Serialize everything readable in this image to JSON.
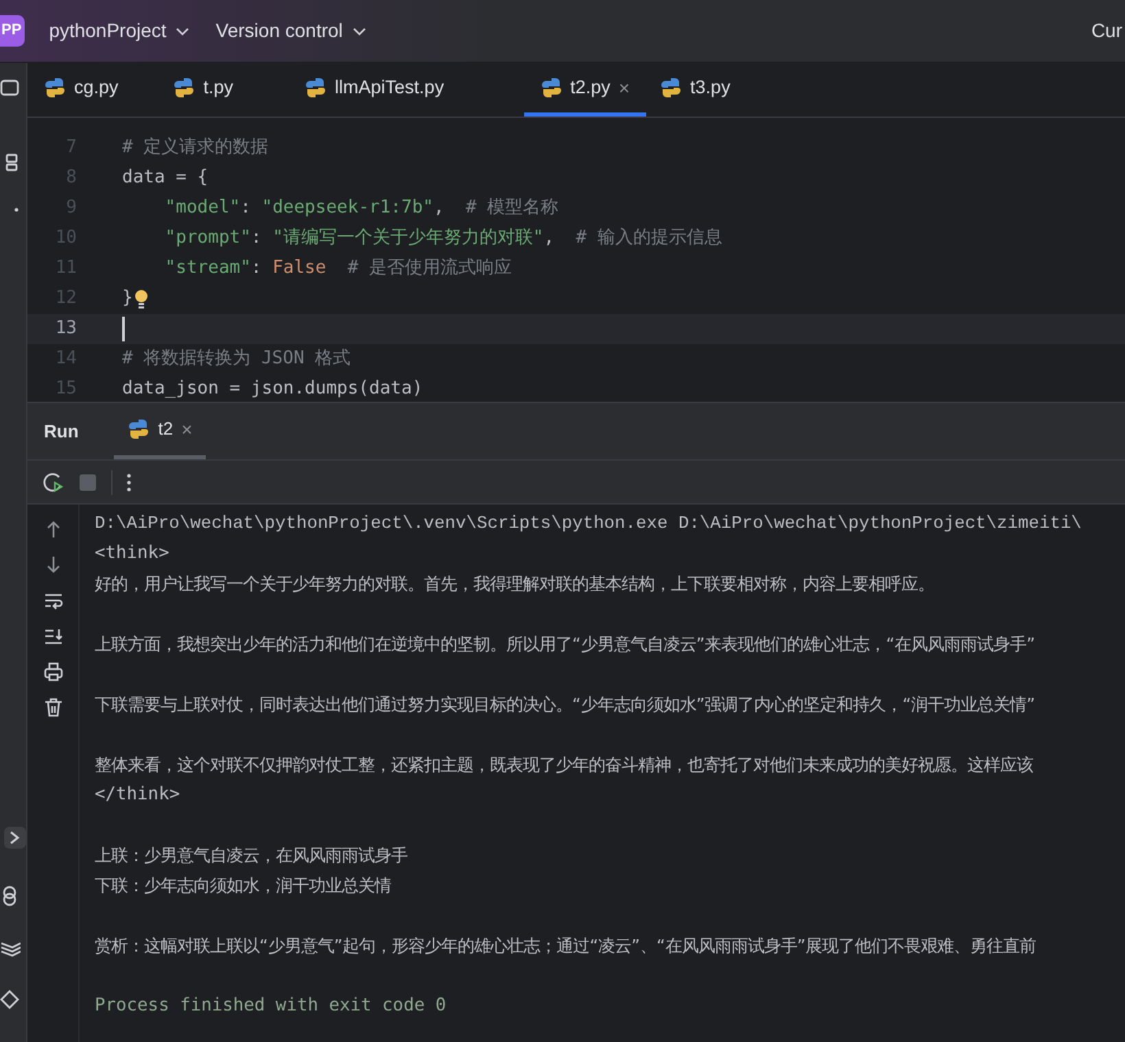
{
  "title_bar": {
    "project_badge": "PP",
    "project": "pythonProject",
    "vcs": "Version control",
    "right_text": "Cur"
  },
  "file_tabs": [
    {
      "label": "cg.py",
      "selected": false
    },
    {
      "label": "t.py",
      "selected": false
    },
    {
      "label": "llmApiTest.py",
      "selected": false
    },
    {
      "label": "t2.py",
      "selected": true,
      "close": "×"
    },
    {
      "label": "t3.py",
      "selected": false
    }
  ],
  "editor": {
    "lines": [
      {
        "number": "7",
        "current": false,
        "tokens": [
          {
            "kind": "comment",
            "text": "# 定义请求的数据"
          }
        ]
      },
      {
        "number": "8",
        "current": false,
        "tokens": [
          {
            "kind": "plain",
            "text": "data = {"
          }
        ]
      },
      {
        "number": "9",
        "current": false,
        "tokens": [
          {
            "kind": "string",
            "text": "    \"model\""
          },
          {
            "kind": "plain",
            "text": ": "
          },
          {
            "kind": "string",
            "text": "\"deepseek-r1:7b\""
          },
          {
            "kind": "plain",
            "text": ",  "
          },
          {
            "kind": "comment",
            "text": "# 模型名称"
          }
        ]
      },
      {
        "number": "10",
        "current": false,
        "tokens": [
          {
            "kind": "string",
            "text": "    \"prompt\""
          },
          {
            "kind": "plain",
            "text": ": "
          },
          {
            "kind": "string",
            "text": "\"请编写一个关于少年努力的对联\""
          },
          {
            "kind": "plain",
            "text": ",  "
          },
          {
            "kind": "comment",
            "text": "# 输入的提示信息"
          }
        ]
      },
      {
        "number": "11",
        "current": false,
        "tokens": [
          {
            "kind": "string",
            "text": "    \"stream\""
          },
          {
            "kind": "plain",
            "text": ": "
          },
          {
            "kind": "keyword",
            "text": "False"
          },
          {
            "kind": "comment",
            "text": "  # 是否使用流式响应"
          }
        ]
      },
      {
        "number": "12",
        "current": false,
        "bulb": true,
        "tokens": [
          {
            "kind": "plain",
            "text": "}"
          }
        ]
      },
      {
        "number": "13",
        "current": true
      },
      {
        "number": "14",
        "current": false,
        "tokens": [
          {
            "kind": "comment",
            "text": "# 将数据转换为 JSON 格式"
          }
        ]
      },
      {
        "number": "15",
        "current": false,
        "tokens": [
          {
            "kind": "plain",
            "text": "data_json = json.dumps(data)"
          }
        ]
      }
    ]
  },
  "run_panel": {
    "title": "Run",
    "tab": {
      "label": "t2",
      "close": "×"
    },
    "console": [
      {
        "kind": "path",
        "text": "D:\\AiPro\\wechat\\pythonProject\\.venv\\Scripts\\python.exe D:\\AiPro\\wechat\\pythonProject\\zimeiti\\"
      },
      {
        "kind": "mono",
        "text": "<think>"
      },
      {
        "kind": "text",
        "text": "好的，用户让我写一个关于少年努力的对联。首先，我得理解对联的基本结构，上下联要相对称，内容上要相呼应。"
      },
      {
        "kind": "blank"
      },
      {
        "kind": "text",
        "text": "上联方面，我想突出少年的活力和他们在逆境中的坚韧。所以用了“少男意气自凌云”来表现他们的雄心壮志，“在风风雨雨试身手”"
      },
      {
        "kind": "blank"
      },
      {
        "kind": "text",
        "text": "下联需要与上联对仗，同时表达出他们通过努力实现目标的决心。“少年志向须如水”强调了内心的坚定和持久，“润干功业总关情”"
      },
      {
        "kind": "blank"
      },
      {
        "kind": "text",
        "text": "整体来看，这个对联不仅押韵对仗工整，还紧扣主题，既表现了少年的奋斗精神，也寄托了对他们未来成功的美好祝愿。这样应该"
      },
      {
        "kind": "mono",
        "text": "</think>"
      },
      {
        "kind": "blank"
      },
      {
        "kind": "text",
        "text": "上联：少男意气自凌云，在风风雨雨试身手"
      },
      {
        "kind": "text",
        "text": "下联：少年志向须如水，润干功业总关情"
      },
      {
        "kind": "blank"
      },
      {
        "kind": "text",
        "text": "赏析：这幅对联上联以“少男意气”起句，形容少年的雄心壮志；通过“凌云”、“在风风雨雨试身手”展现了他们不畏艰难、勇往直前"
      },
      {
        "kind": "blank"
      },
      {
        "kind": "status",
        "text": "Process finished with exit code 0"
      }
    ]
  }
}
